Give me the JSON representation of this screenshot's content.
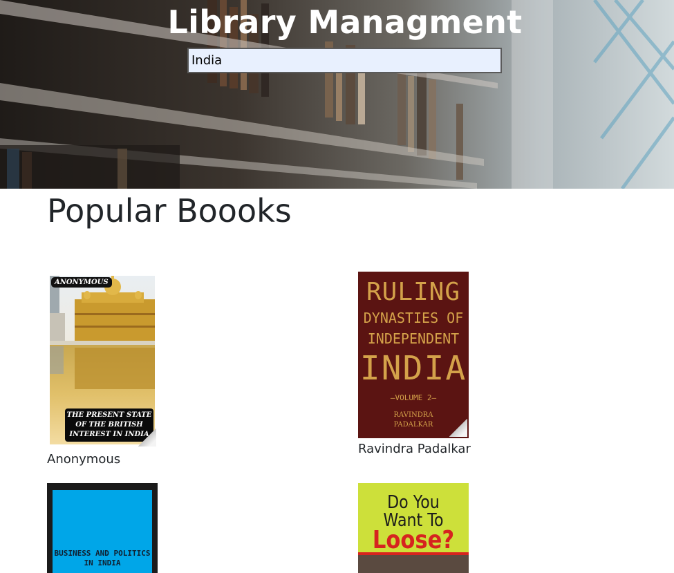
{
  "header": {
    "title": "Library Managment",
    "search_value": "India"
  },
  "main": {
    "section_title": "Popular Boooks",
    "books": [
      {
        "author": "Anonymous",
        "cover": {
          "badge": "ANONYMOUS",
          "title_lines": [
            "THE PRESENT STATE",
            "OF THE BRITISH",
            "INTEREST IN INDIA"
          ]
        }
      },
      {
        "author": "Ravindra Padalkar",
        "cover": {
          "title_lines": [
            "RULING",
            "DYNASTIES OF",
            "INDEPENDENT",
            "INDIA"
          ],
          "volume": "—VOLUME 2—",
          "author_lines": [
            "RAVINDRA",
            "PADALKAR"
          ]
        }
      },
      {
        "author": "",
        "cover": {
          "title_lines": [
            "BUSINESS AND POLITICS",
            "IN INDIA"
          ]
        }
      },
      {
        "author": "",
        "cover": {
          "title_lines": [
            "Do You",
            "Want To",
            "Loose?"
          ]
        }
      }
    ]
  },
  "colors": {
    "title": "#ffffff",
    "search_bg": "#e8f0fe",
    "text": "#212529"
  }
}
